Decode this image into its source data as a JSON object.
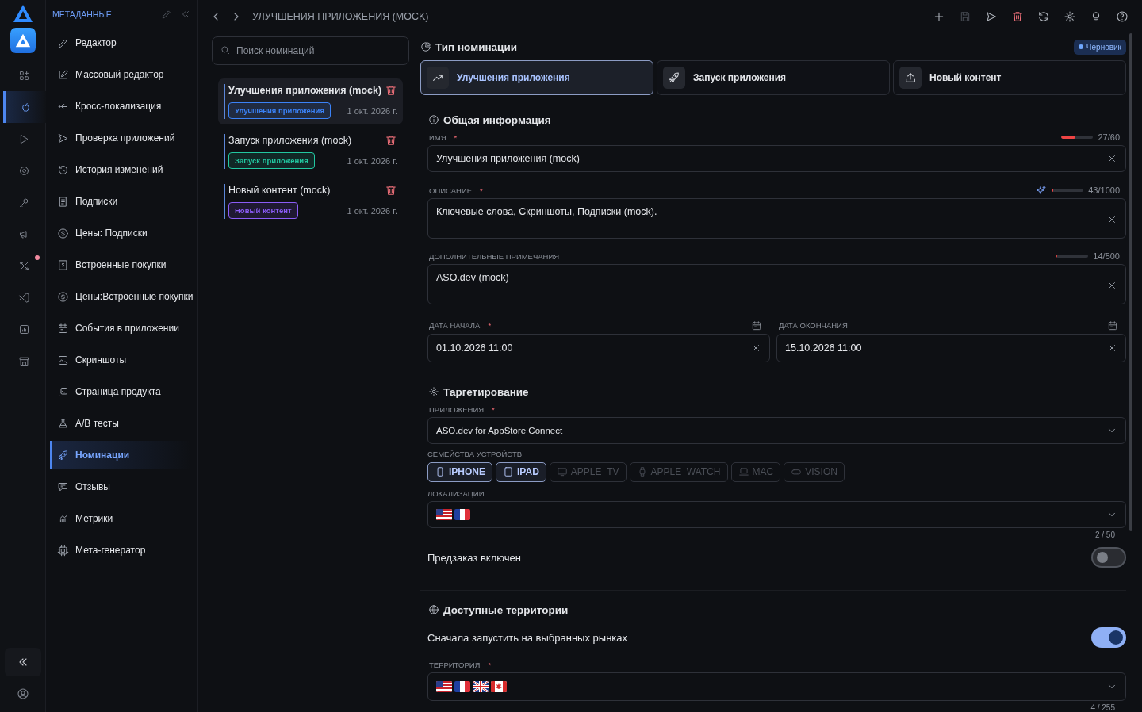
{
  "rail": {
    "items": [
      {
        "selected": false,
        "badge": false
      },
      {
        "selected": true,
        "badge": false
      },
      {
        "selected": false,
        "badge": false
      },
      {
        "selected": false,
        "badge": false
      },
      {
        "selected": false,
        "badge": false
      },
      {
        "selected": false,
        "badge": false
      },
      {
        "selected": false,
        "badge": true
      },
      {
        "selected": false,
        "badge": false
      },
      {
        "selected": false,
        "badge": false
      },
      {
        "selected": false,
        "badge": false
      }
    ]
  },
  "sidebar": {
    "title": "МЕТАДАННЫЕ",
    "items": [
      {
        "label": "Редактор",
        "selected": false
      },
      {
        "label": "Массовый редактор",
        "selected": false
      },
      {
        "label": "Кросс-локализация",
        "selected": false
      },
      {
        "label": "Проверка приложений",
        "selected": false
      },
      {
        "label": "История изменений",
        "selected": false
      },
      {
        "label": "Подписки",
        "selected": false
      },
      {
        "label": "Цены: Подписки",
        "selected": false
      },
      {
        "label": "Встроенные покупки",
        "selected": false
      },
      {
        "label": "Цены:Встроенные покупки",
        "selected": false
      },
      {
        "label": "События в приложении",
        "selected": false
      },
      {
        "label": "Скриншоты",
        "selected": false
      },
      {
        "label": "Страница продукта",
        "selected": false
      },
      {
        "label": "A/B тесты",
        "selected": false
      },
      {
        "label": "Номинации",
        "selected": true
      },
      {
        "label": "Отзывы",
        "selected": false
      },
      {
        "label": "Метрики",
        "selected": false
      },
      {
        "label": "Мета-генератор",
        "selected": false
      }
    ]
  },
  "breadcrumb": "УЛУЧШЕНИЯ ПРИЛОЖЕНИЯ (MOCK)",
  "search": {
    "placeholder": "Поиск номинаций"
  },
  "nominations": [
    {
      "title": "Улучшения приложения (mock)",
      "tag": "Улучшения приложения",
      "color": "#3b82f6",
      "date": "1 окт. 2026 г.",
      "selected": true
    },
    {
      "title": "Запуск приложения (mock)",
      "tag": "Запуск приложения",
      "color": "#22c7a0",
      "date": "1 окт. 2026 г.",
      "selected": false
    },
    {
      "title": "Новый контент (mock)",
      "tag": "Новый контент",
      "color": "#8b5cf6",
      "date": "1 окт. 2026 г.",
      "selected": false
    }
  ],
  "form": {
    "type_title": "Тип номинации",
    "status": "Черновик",
    "types": [
      {
        "label": "Улучшения приложения",
        "kind": "trend",
        "selected": true
      },
      {
        "label": "Запуск приложения",
        "kind": "rocket",
        "selected": false
      },
      {
        "label": "Новый контент",
        "kind": "upload",
        "selected": false
      }
    ],
    "general_title": "Общая информация",
    "name": {
      "label": "ИМЯ",
      "required_mark": "*",
      "value": "Улучшения приложения (mock)",
      "counter": "27/60",
      "level": 0.45
    },
    "description": {
      "label": "ОПИСАНИЕ",
      "required_mark": "*",
      "value": "Ключевые слова, Скриншоты, Подписки (mock).",
      "counter": "43/1000",
      "level": 0.043
    },
    "notes": {
      "label": "ДОПОЛНИТЕЛЬНЫЕ ПРИМЕЧАНИЯ",
      "value": "ASO.dev (mock)",
      "counter": "14/500",
      "level": 0.028
    },
    "start_date": {
      "label": "ДАТА НАЧАЛА",
      "required_mark": "*",
      "value": "01.10.2026 11:00"
    },
    "end_date": {
      "label": "ДАТА ОКОНЧАНИЯ",
      "value": "15.10.2026 11:00"
    },
    "targeting_title": "Таргетирование",
    "apps": {
      "label": "ПРИЛОЖЕНИЯ",
      "required_mark": "*",
      "value": "ASO.dev for AppStore Connect"
    },
    "devices_label": "СЕМЕЙСТВА УСТРОЙСТВ",
    "devices": [
      {
        "label": "IPHONE",
        "kind": "phone",
        "selected": true
      },
      {
        "label": "IPAD",
        "kind": "tablet",
        "selected": true
      },
      {
        "label": "APPLE_TV",
        "kind": "tv",
        "selected": false
      },
      {
        "label": "APPLE_WATCH",
        "kind": "watch",
        "selected": false
      },
      {
        "label": "MAC",
        "kind": "laptop",
        "selected": false
      },
      {
        "label": "VISION",
        "kind": "headset",
        "selected": false
      }
    ],
    "localizations": {
      "label": "ЛОКАЛИЗАЦИИ",
      "flags": [
        {
          "kind": "us"
        },
        {
          "kind": "fr"
        }
      ],
      "counter": "2 / 50"
    },
    "preorder": {
      "label": "Предзаказ включен",
      "on": false
    },
    "territories_title": "Доступные территории",
    "first_launch": {
      "label": "Сначала запустить на выбранных рынках",
      "on": true
    },
    "territory": {
      "label": "ТЕРРИТОРИЯ",
      "required_mark": "*",
      "flags": [
        {
          "kind": "us"
        },
        {
          "kind": "fr"
        },
        {
          "kind": "gb"
        },
        {
          "kind": "ca"
        }
      ],
      "counter": "4 / 255"
    }
  }
}
